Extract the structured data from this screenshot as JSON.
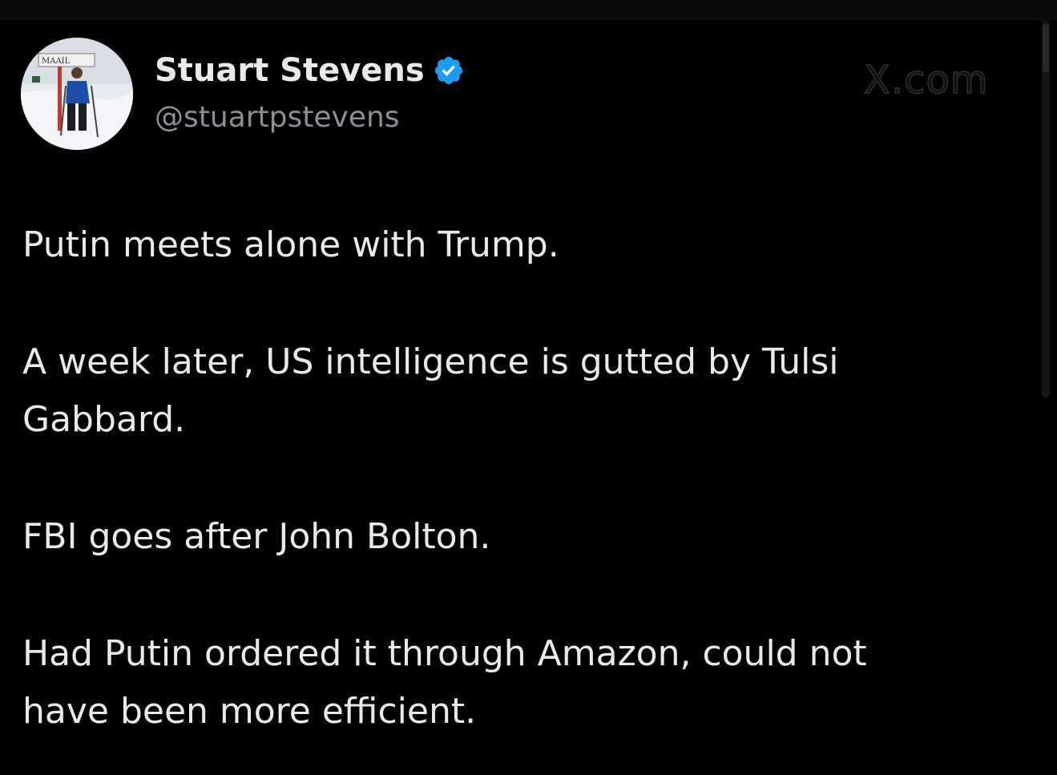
{
  "author": {
    "display_name": "Stuart Stevens",
    "handle": "@stuartpstevens",
    "verified": true,
    "verified_color": "#1d9bf0",
    "avatar_sign_text": "MAAIL"
  },
  "watermark": "X.com",
  "tweet": {
    "paragraphs": [
      "Putin meets alone with Trump.",
      "A week later, US intelligence is gutted by Tulsi\nGabbard.",
      "FBI goes after John Bolton.",
      "Had Putin ordered it through Amazon, could not\nhave been more efficient."
    ]
  },
  "colors": {
    "background": "#000000",
    "text_primary": "#e7e9ea",
    "text_secondary": "#8b9096"
  }
}
